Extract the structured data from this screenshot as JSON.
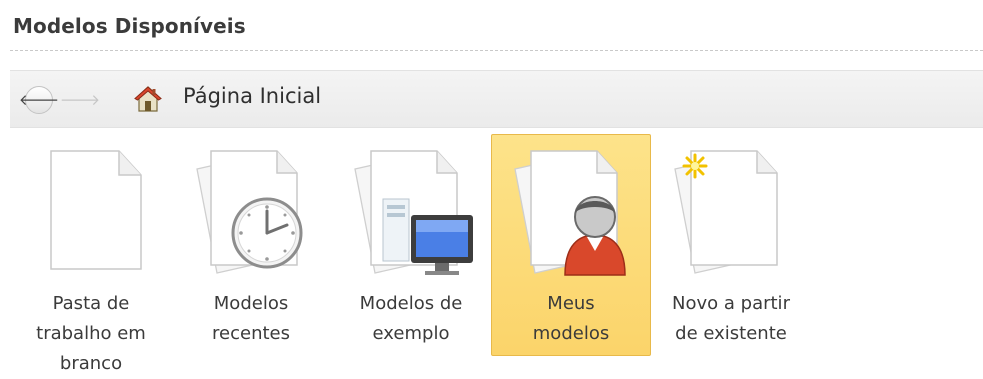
{
  "section": {
    "title": "Modelos Disponíveis"
  },
  "nav": {
    "back_icon": "back-arrow-icon",
    "forward_icon": "forward-arrow-icon",
    "home_icon": "home-icon",
    "breadcrumb": "Página Inicial"
  },
  "templates": [
    {
      "label": "Pasta de\ntrabalho em\nbranco",
      "icon": "blank-workbook-icon",
      "selected": false
    },
    {
      "label": "Modelos\nrecentes",
      "icon": "recent-templates-icon",
      "selected": false
    },
    {
      "label": "Modelos de\nexemplo",
      "icon": "sample-templates-icon",
      "selected": false
    },
    {
      "label": "Meus\nmodelos",
      "icon": "my-templates-icon",
      "selected": true
    },
    {
      "label": "Novo a partir\nde existente",
      "icon": "new-from-existing-icon",
      "selected": false
    }
  ],
  "colors": {
    "selected_bg": "#fcd979",
    "selected_border": "#e8b94a"
  }
}
